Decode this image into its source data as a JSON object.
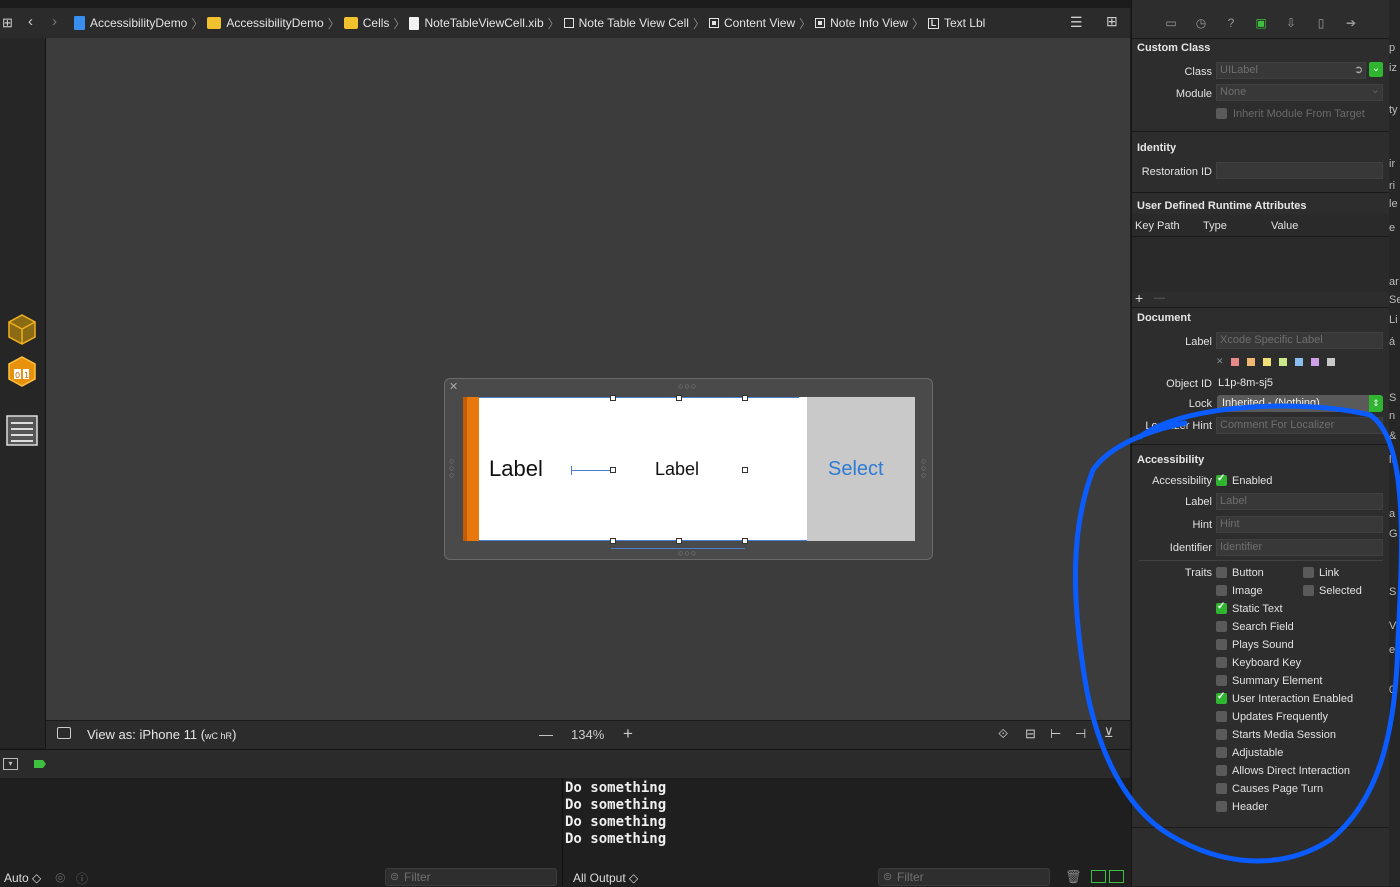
{
  "breadcrumbs": [
    {
      "label": "AccessibilityDemo",
      "icon": "project-icon"
    },
    {
      "label": "AccessibilityDemo",
      "icon": "folder-icon"
    },
    {
      "label": "Cells",
      "icon": "folder-icon"
    },
    {
      "label": "NoteTableViewCell.xib",
      "icon": "xib-file-icon"
    },
    {
      "label": "Note Table View Cell",
      "icon": "table-cell-icon"
    },
    {
      "label": "Content View",
      "icon": "view-icon"
    },
    {
      "label": "Note Info View",
      "icon": "view-icon"
    },
    {
      "label": "Text Lbl",
      "icon": "label-icon"
    }
  ],
  "canvas": {
    "cell": {
      "label_left": "Label",
      "label_center": "Label",
      "select_button": "Select"
    },
    "view_as": "View as: iPhone 11 (",
    "view_as_sizeclass": "wC hR",
    "view_as_close": ")",
    "zoom": "134%",
    "zoom_minus": "—",
    "zoom_plus": "+"
  },
  "inspector": {
    "custom_class": {
      "header": "Custom Class",
      "class_label": "Class",
      "class_placeholder": "UILabel",
      "module_label": "Module",
      "module_placeholder": "None",
      "inherit_label": "Inherit Module From Target"
    },
    "identity": {
      "header": "Identity",
      "restoration_label": "Restoration ID"
    },
    "runtime_attrs": {
      "header": "User Defined Runtime Attributes",
      "columns": [
        "Key Path",
        "Type",
        "Value"
      ],
      "add": "+",
      "remove": "—"
    },
    "document": {
      "header": "Document",
      "label_label": "Label",
      "label_placeholder": "Xcode Specific Label",
      "color_swatches": [
        "#e88a8a",
        "#f0b870",
        "#f0e07a",
        "#c8e88a",
        "#8ac0f0",
        "#d0a0e8",
        "#c8c8c8"
      ],
      "object_id_label": "Object ID",
      "object_id": "L1p-8m-sj5",
      "lock_label": "Lock",
      "lock_value": "Inherited - (Nothing)",
      "localizer_label": "Localizer Hint",
      "localizer_placeholder": "Comment For Localizer"
    },
    "accessibility": {
      "header": "Accessibility",
      "accessibility_label": "Accessibility",
      "enabled_label": "Enabled",
      "enabled": true,
      "label_label": "Label",
      "label_placeholder": "Label",
      "hint_label": "Hint",
      "hint_placeholder": "Hint",
      "identifier_label": "Identifier",
      "identifier_placeholder": "Identifier",
      "traits_label": "Traits",
      "traits_col1": [
        {
          "label": "Button",
          "checked": false
        },
        {
          "label": "Image",
          "checked": false
        },
        {
          "label": "Static Text",
          "checked": true
        },
        {
          "label": "Search Field",
          "checked": false
        },
        {
          "label": "Plays Sound",
          "checked": false
        },
        {
          "label": "Keyboard Key",
          "checked": false
        },
        {
          "label": "Summary Element",
          "checked": false
        },
        {
          "label": "User Interaction Enabled",
          "checked": true
        },
        {
          "label": "Updates Frequently",
          "checked": false
        },
        {
          "label": "Starts Media Session",
          "checked": false
        },
        {
          "label": "Adjustable",
          "checked": false
        },
        {
          "label": "Allows Direct Interaction",
          "checked": false
        },
        {
          "label": "Causes Page Turn",
          "checked": false
        },
        {
          "label": "Header",
          "checked": false
        }
      ],
      "traits_col2": [
        {
          "label": "Link",
          "checked": false
        },
        {
          "label": "Selected",
          "checked": false
        }
      ]
    }
  },
  "debug": {
    "console_lines": [
      "Do something",
      "Do something",
      "Do something",
      "Do something"
    ],
    "auto_label": "Auto ◇",
    "all_output": "All Output ◇",
    "filter_placeholder": "Filter"
  },
  "sliver_text": [
    "p",
    "iz",
    "ty",
    "ir",
    "ri",
    "le",
    "e",
    "ar",
    "Se",
    "Li",
    "á",
    "S",
    "n",
    "&",
    "ls",
    "a",
    "G",
    "S",
    "V",
    "ed",
    "0"
  ],
  "colors": {
    "annotation": "#0a5cff",
    "accent_green": "#2fb52f",
    "orange": "#e8780c",
    "select_blue": "#2e7bd6"
  }
}
